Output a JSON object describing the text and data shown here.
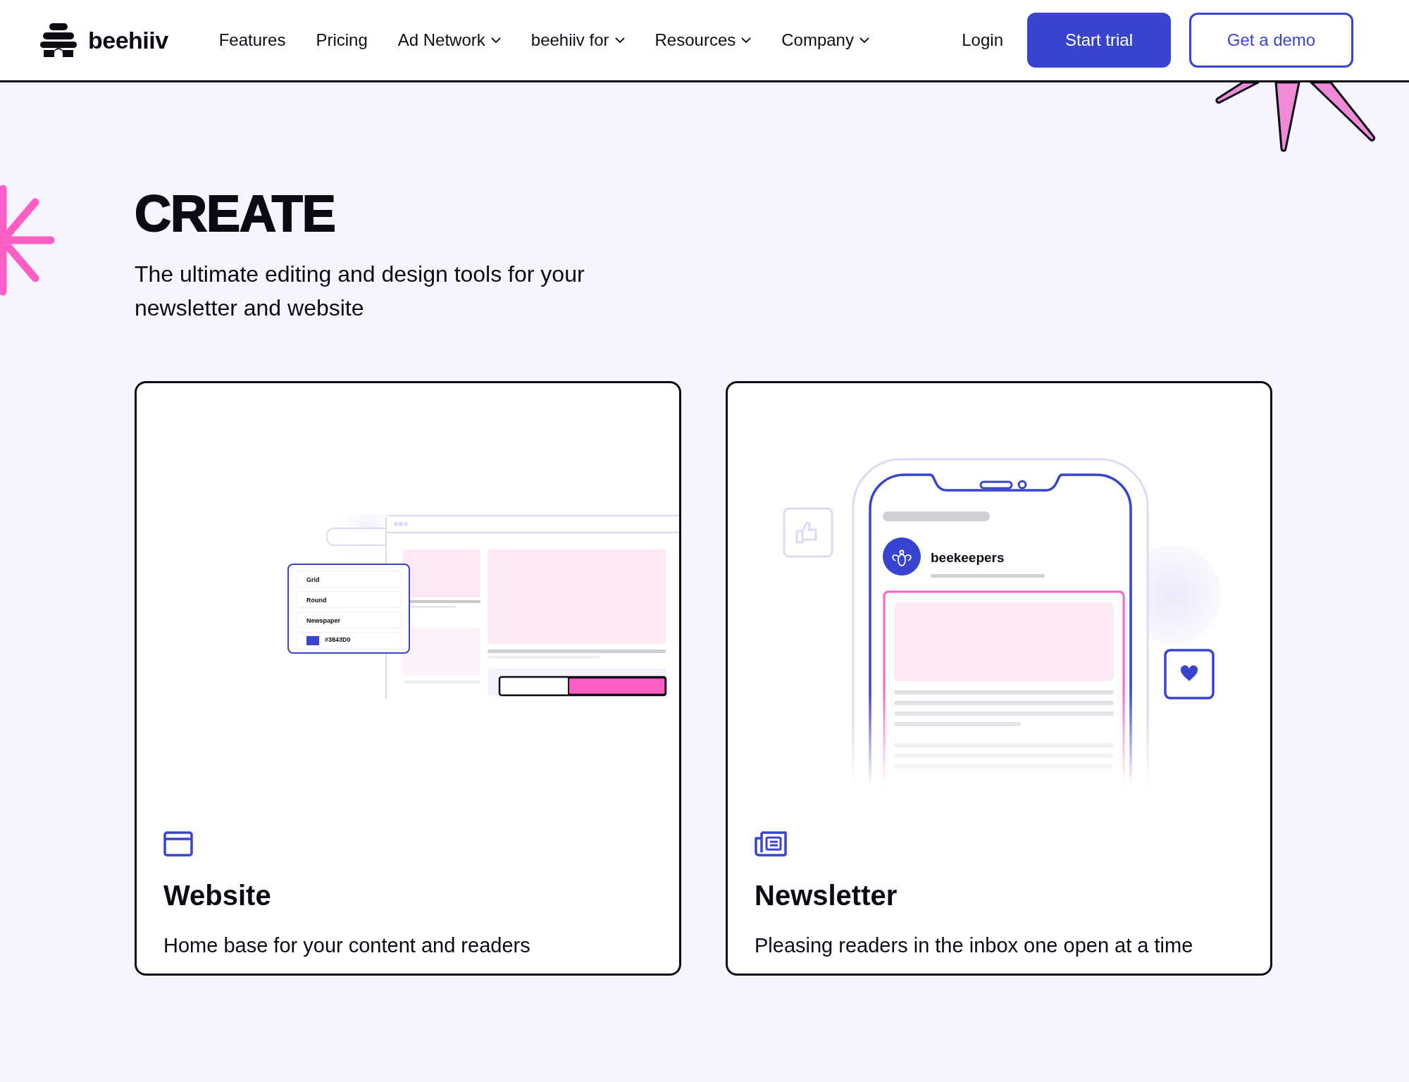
{
  "nav": {
    "logo": "beehiiv",
    "links": [
      {
        "label": "Features",
        "dropdown": false
      },
      {
        "label": "Pricing",
        "dropdown": false
      },
      {
        "label": "Ad Network",
        "dropdown": true
      },
      {
        "label": "beehiiv for",
        "dropdown": true
      },
      {
        "label": "Resources",
        "dropdown": true
      },
      {
        "label": "Company",
        "dropdown": true
      }
    ],
    "login": "Login",
    "buttons": [
      {
        "label": "Start trial",
        "kind": "primary"
      },
      {
        "label": "Get a demo",
        "kind": "outline"
      }
    ]
  },
  "hero": {
    "title": "CREATE",
    "subtitle": "The ultimate editing and design tools for your newsletter and website"
  },
  "cards": [
    {
      "kind": "website",
      "title": "Website",
      "description": "Home base for your content and readers",
      "mockup": {
        "options": [
          "Grid",
          "Round",
          "Newspaper"
        ],
        "swatch_label": "#3843D0"
      }
    },
    {
      "kind": "newsletter",
      "title": "Newsletter",
      "description": "Pleasing readers in the inbox one open at a time",
      "mockup": {
        "publication": "beekeepers"
      }
    }
  ]
}
